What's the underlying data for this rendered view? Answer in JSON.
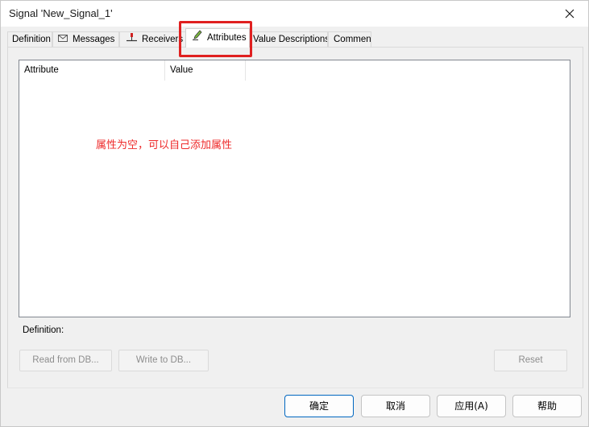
{
  "window": {
    "title": "Signal 'New_Signal_1'"
  },
  "tabs": [
    {
      "label": "Definition",
      "icon": ""
    },
    {
      "label": "Messages",
      "icon": "envelope-icon"
    },
    {
      "label": "Receivers",
      "icon": "receiver-icon"
    },
    {
      "label": "Attributes",
      "icon": "pencil-icon",
      "active": true
    },
    {
      "label": "Value Descriptions",
      "icon": ""
    },
    {
      "label": "Comment",
      "icon": ""
    }
  ],
  "list": {
    "columns": [
      "Attribute",
      "Value"
    ],
    "rows": []
  },
  "annotation": {
    "text": "属性为空，可以自己添加属性",
    "color": "#ee2a2a"
  },
  "definition_label": "Definition:",
  "buttons": {
    "read_from_db": "Read from DB...",
    "write_to_db": "Write to DB...",
    "reset": "Reset",
    "ok": "确定",
    "cancel": "取消",
    "apply": "应用(A)",
    "help": "帮助"
  },
  "colors": {
    "highlight": "#e02020",
    "default_button_border": "#0067c0"
  }
}
